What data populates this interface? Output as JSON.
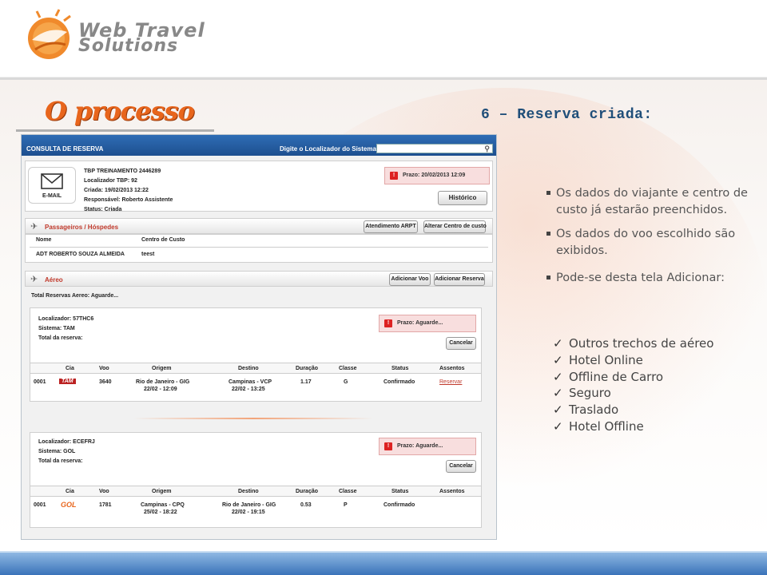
{
  "logo": {
    "line1": "Web Travel",
    "line2": "Solutions"
  },
  "slide": {
    "title": "O processo",
    "step": "6 – Reserva criada:"
  },
  "screenshot": {
    "topbar": {
      "title": "CONSULTA DE RESERVA",
      "search_label": "Digite o Localizador do Sistema:",
      "search_value": ""
    },
    "reservation": {
      "email_label": "E-MAIL",
      "lines": [
        "TBP TREINAMENTO 2446289",
        "Localizador TBP: 92",
        "Criada: 19/02/2013 12:22",
        "Responsável: Roberto Assistente",
        "Status: Criada"
      ],
      "prazo": "Prazo: 20/02/2013 12:09",
      "historico_button": "Histórico"
    },
    "passengers": {
      "title": "Passageiros / Hóspedes",
      "button_arpt": "Atendimento ARPT",
      "button_centro": "Alterar Centro de custo",
      "headers": [
        "Nome",
        "Centro de Custo"
      ],
      "row": [
        "ADT ROBERTO SOUZA ALMEIDA",
        "teest"
      ]
    },
    "air": {
      "title": "Aéreo",
      "button_add_voo": "Adicionar Voo",
      "button_add_reserva": "Adicionar Reserva",
      "total_label": "Total Reservas Aereo: Aguarde...",
      "columns": [
        "Cia",
        "Voo",
        "Origem",
        "Destino",
        "Duração",
        "Classe",
        "Status",
        "Assentos"
      ],
      "bookings": [
        {
          "localizador": "Localizador: 57THC6",
          "sistema": "Sistema: TAM",
          "total": "Total da reserva:",
          "prazo": "Prazo: Aguarde...",
          "cancel": "Cancelar",
          "row": {
            "num": "0001",
            "airline": "TAM",
            "voo": "3640",
            "origem": "Rio de Janeiro - GIG",
            "origem_time": "22/02 - 12:09",
            "destino": "Campinas - VCP",
            "destino_time": "22/02 - 13:25",
            "duracao": "1.17",
            "classe": "G",
            "status": "Confirmado",
            "assentos": "Reservar"
          }
        },
        {
          "localizador": "Localizador: ECEFRJ",
          "sistema": "Sistema: GOL",
          "total": "Total da reserva:",
          "prazo": "Prazo: Aguarde...",
          "cancel": "Cancelar",
          "row": {
            "num": "0001",
            "airline": "GOL",
            "voo": "1781",
            "origem": "Campinas - CPQ",
            "origem_time": "25/02 - 18:22",
            "destino": "Rio de Janeiro - GIG",
            "destino_time": "22/02 - 19:15",
            "duracao": "0.53",
            "classe": "P",
            "status": "Confirmado",
            "assentos": ""
          }
        }
      ]
    }
  },
  "bullets": [
    "Os dados do viajante e centro de custo já estarão preenchidos.",
    "Os dados do voo escolhido são exibidos.",
    "Pode-se desta tela Adicionar:"
  ],
  "add_options": [
    "Outros trechos de aéreo",
    "Hotel Online",
    "Offline de Carro",
    "Seguro",
    "Traslado",
    "Hotel Offline"
  ],
  "colors": {
    "accent_orange": "#e8651c",
    "title_blue": "#1f4e79",
    "topbar_blue": "#2f6db5",
    "alert_red": "#c0392b"
  }
}
